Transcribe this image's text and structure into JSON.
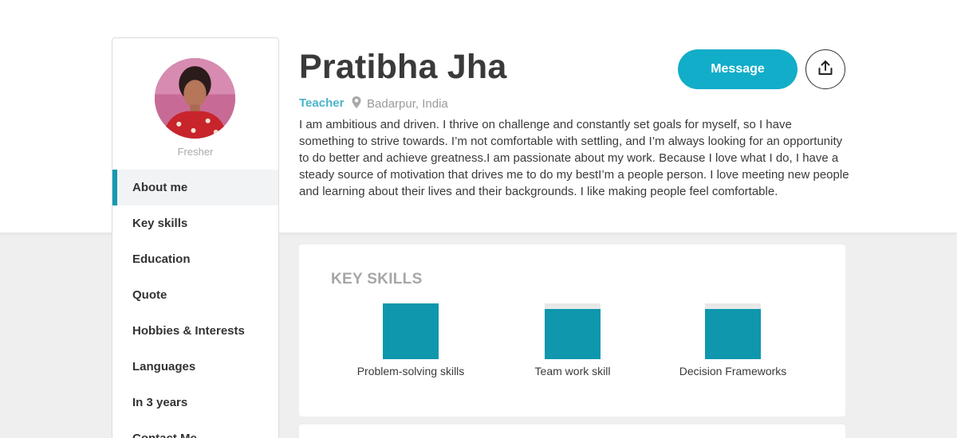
{
  "profile": {
    "name": "Pratibha Jha",
    "role": "Teacher",
    "location": "Badarpur, India",
    "status": "Fresher",
    "about": "I am ambitious and driven. I thrive on challenge and constantly set goals for myself, so I have something to strive towards. I’m not comfortable with settling, and I’m always looking for an opportunity to do better and achieve greatness.I am passionate about my work. Because I love what I do, I have a steady source of motivation that drives me to do my bestI’m a people person. I love meeting new people and learning about their lives and their backgrounds. I like making people feel comfortable."
  },
  "actions": {
    "message_label": "Message",
    "share_icon": "share-upload-icon"
  },
  "sidebar": {
    "active": "About me",
    "items": [
      {
        "label": "About me"
      },
      {
        "label": "Key skills"
      },
      {
        "label": "Education"
      },
      {
        "label": "Quote"
      },
      {
        "label": "Hobbies & Interests"
      },
      {
        "label": "Languages"
      },
      {
        "label": "In 3 years"
      },
      {
        "label": "Contact Me"
      }
    ]
  },
  "key_skills": {
    "title": "KEY SKILLS",
    "items": [
      {
        "label": "Problem-solving skills",
        "level": 1.0
      },
      {
        "label": "Team work skill",
        "level": 0.9
      },
      {
        "label": "Decision Frameworks",
        "level": 0.9
      }
    ]
  },
  "colors": {
    "accent": "#12adc9",
    "bar_fill": "#0e97ad",
    "role_text": "#4ab3c9",
    "page_bg": "#efefef"
  },
  "icons": {
    "location": "map-pin-icon",
    "share": "share-upload-icon"
  }
}
